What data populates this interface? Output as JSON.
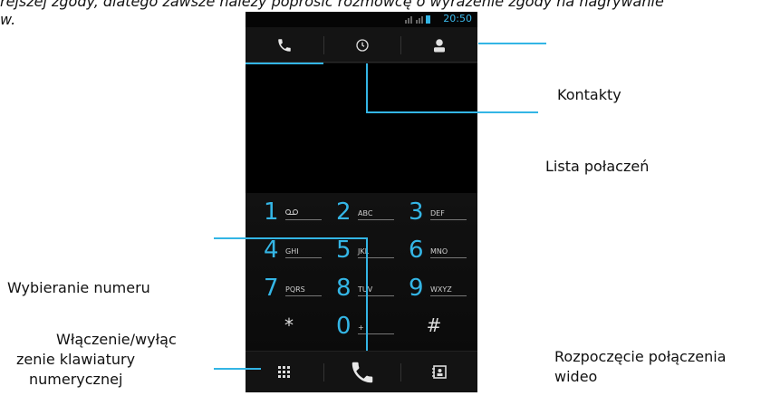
{
  "doc": {
    "line1": "rejszej zgody, dlatego zawsze należy poprosić rozmówcę o wyrażenie zgody na nagrywanie",
    "line2": "w."
  },
  "status": {
    "time": "20:50"
  },
  "tabs": [
    {
      "name": "dialer",
      "icon": "phone-icon"
    },
    {
      "name": "call-log",
      "icon": "clock-icon"
    },
    {
      "name": "contacts",
      "icon": "person-icon"
    }
  ],
  "keys": [
    {
      "digit": "1",
      "letters": "○○"
    },
    {
      "digit": "2",
      "letters": "ABC"
    },
    {
      "digit": "3",
      "letters": "DEF"
    },
    {
      "digit": "4",
      "letters": "GHI"
    },
    {
      "digit": "5",
      "letters": "JKL"
    },
    {
      "digit": "6",
      "letters": "MNO"
    },
    {
      "digit": "7",
      "letters": "PQRS"
    },
    {
      "digit": "8",
      "letters": "TUV"
    },
    {
      "digit": "9",
      "letters": "WXYZ"
    },
    {
      "digit": "*",
      "letters": ""
    },
    {
      "digit": "0",
      "letters": "+"
    },
    {
      "digit": "#",
      "letters": ""
    }
  ],
  "labels": {
    "contacts": "Kontakty",
    "call_log": "Lista połaczeń",
    "dialing": "Wybieranie numeru",
    "keyboard_toggle_1": "Włączenie/wyłąc",
    "keyboard_toggle_2": "zenie klawiatury",
    "keyboard_toggle_3": "numerycznej",
    "video_call_1": "Rozpoczęcie połączenia",
    "video_call_2": "wideo"
  },
  "colors": {
    "accent": "#33b5e5"
  }
}
